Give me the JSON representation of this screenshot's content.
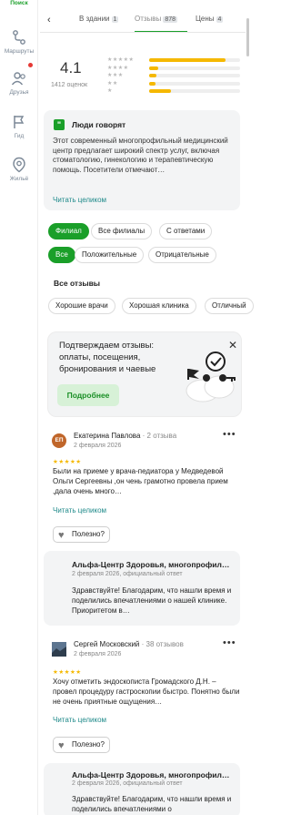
{
  "rail": [
    {
      "id": "search",
      "label": "Поиск",
      "icon": "search-icon",
      "active": true
    },
    {
      "id": "routes",
      "label": "Маршруты",
      "icon": "route-icon"
    },
    {
      "id": "friends",
      "label": "Друзья",
      "icon": "friends-icon"
    },
    {
      "id": "guide",
      "label": "Гид",
      "icon": "flag-icon"
    },
    {
      "id": "housing",
      "label": "Жильё",
      "icon": "housing-icon"
    }
  ],
  "tabs": [
    {
      "label": "В здании",
      "count": "1"
    },
    {
      "label": "Отзывы",
      "count": "878",
      "active": true
    },
    {
      "label": "Цены",
      "count": "4"
    }
  ],
  "rating": {
    "value": "4.1",
    "count_text": "1412 оценок",
    "distribution": [
      {
        "stars": 5,
        "fraction": 0.84
      },
      {
        "stars": 4,
        "fraction": 0.1
      },
      {
        "stars": 3,
        "fraction": 0.08
      },
      {
        "stars": 2,
        "fraction": 0.07
      },
      {
        "stars": 1,
        "fraction": 0.24
      }
    ]
  },
  "people_say": {
    "title": "Люди говорят",
    "text": "Этот современный многопрофильный медицинский центр предлагает широкий спектр услуг, включая стоматологию, гинекологию и терапевтическую помощь. Посетители отмечают…",
    "more": "Читать целиком"
  },
  "filters_branch": [
    "Филиал",
    "Все филиалы",
    "С ответами"
  ],
  "filters_tone": [
    "Все",
    "Положительные",
    "Отрицательные"
  ],
  "all_reviews_title": "Все отзывы",
  "tags": [
    "Хорошие врачи",
    "Хорошая клиника",
    "Отличный"
  ],
  "promo": {
    "text": "Подтверждаем отзывы: оплаты, посещения, бронирования и чаевые",
    "button": "Подробнее"
  },
  "reviews": [
    {
      "initials": "ЕП",
      "avatar_color": "#c0662a",
      "name": "Екатерина Павлова",
      "meta": " · 2 отзыва",
      "date": "2 февраля 2026",
      "stars": 5,
      "text": "Были на приеме у врача-педиатора у Медведевой Ольги Сергеевны ,он чень грамотно провела прием ,дала очень много…",
      "more": "Читать целиком",
      "helpful": "Полезно?",
      "reply": {
        "name": "Альфа-Центр Здоровья, многопрофил…",
        "date": "2 февраля 2026, официальный ответ",
        "text": "Здравствуйте! Благодарим, что нашли время и поделились впечатлениями о нашей клинике. Приоритетом в…"
      }
    },
    {
      "initials": "",
      "avatar_color": "#6b7c8c",
      "name": "Сергей Московский",
      "meta": " · 38 отзывов",
      "date": "2 февраля 2026",
      "stars": 5,
      "text": "Хочу отметить эндоскописта Громадского Д.Н. – провел процедуру гастроскопии быстро. Понятно были не очень приятные ощущения…",
      "more": "Читать целиком",
      "helpful": "Полезно?",
      "reply": {
        "name": "Альфа-Центр Здоровья, многопрофил…",
        "date": "2 февраля 2026, официальный ответ",
        "text": "Здравствуйте! Благодарим, что нашли время и поделились впечатлениями о"
      }
    }
  ],
  "colors": {
    "accent": "#1a9f29",
    "link": "#1f8a8a",
    "star": "#f5b800"
  }
}
